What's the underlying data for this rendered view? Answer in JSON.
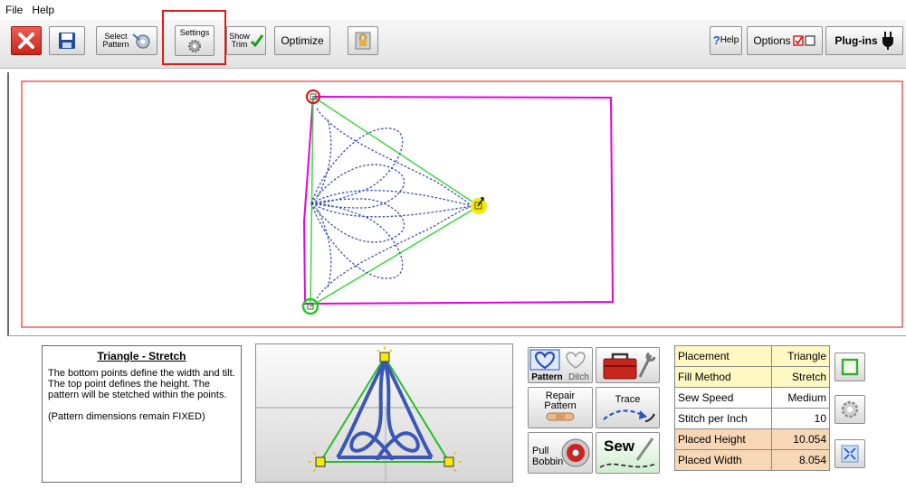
{
  "menu": {
    "file": "File",
    "help": "Help"
  },
  "toolbar": {
    "close_icon": "close-icon",
    "save_icon": "save-icon",
    "select_pattern_line1": "Select",
    "select_pattern_line2": "Pattern",
    "settings_label": "Settings",
    "show_trim_line1": "Show",
    "show_trim_line2": "Trim",
    "optimize_label": "Optimize",
    "help_label": "Help",
    "help_q": "?",
    "options_label": "Options",
    "plugins_label": "Plug-ins"
  },
  "info": {
    "title": "Triangle - Stretch",
    "text": "The bottom points define the width and tilt. The top point defines the height. The pattern will be stetched within the points.",
    "note": "(Pattern dimensions remain FIXED)"
  },
  "buttons": {
    "pattern_label": "Pattern",
    "ditch_label": "Ditch",
    "repair_line1": "Repair",
    "repair_line2": "Pattern",
    "trace_label": "Trace",
    "pull_line1": "Pull",
    "pull_line2": "Bobbin",
    "sew_label": "Sew"
  },
  "properties": [
    {
      "label": "Placement",
      "value": "Triangle"
    },
    {
      "label": "Fill Method",
      "value": "Stretch"
    },
    {
      "label": "Sew Speed",
      "value": "Medium"
    },
    {
      "label": "Stitch per Inch",
      "value": "10"
    },
    {
      "label": "Placed Height",
      "value": "10.054"
    },
    {
      "label": "Placed Width",
      "value": "8.054"
    }
  ],
  "colors": {
    "accent_red": "#e01919",
    "magenta": "#e600e6",
    "green": "#22cc22",
    "stitch_blue": "#3a4fb0",
    "yellow_handle": "#f5ea00"
  }
}
